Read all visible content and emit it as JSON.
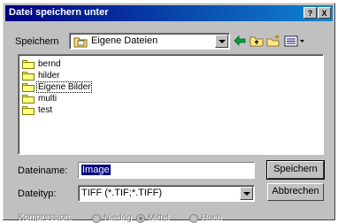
{
  "window": {
    "title": "Datei speichern unter"
  },
  "title_buttons": {
    "help": "?",
    "close": "X"
  },
  "location": {
    "label": "Speichern",
    "value": "Eigene Dateien"
  },
  "files": [
    {
      "name": "bernd"
    },
    {
      "name": "hilder"
    },
    {
      "name": "Eigene Bilder"
    },
    {
      "name": "multi"
    },
    {
      "name": "test"
    }
  ],
  "filename": {
    "label": "Dateiname:",
    "value": "Image"
  },
  "filetype": {
    "label": "Dateityp:",
    "value": "TIFF (*.TIF;*.TIFF)"
  },
  "buttons": {
    "save": "Speichern",
    "cancel": "Abbrechen"
  },
  "compression": {
    "label": "Kompression:",
    "options": [
      {
        "label": "Niedrig",
        "selected": false
      },
      {
        "label": "Mittel",
        "selected": true
      },
      {
        "label": "Hoch",
        "selected": false
      }
    ]
  }
}
